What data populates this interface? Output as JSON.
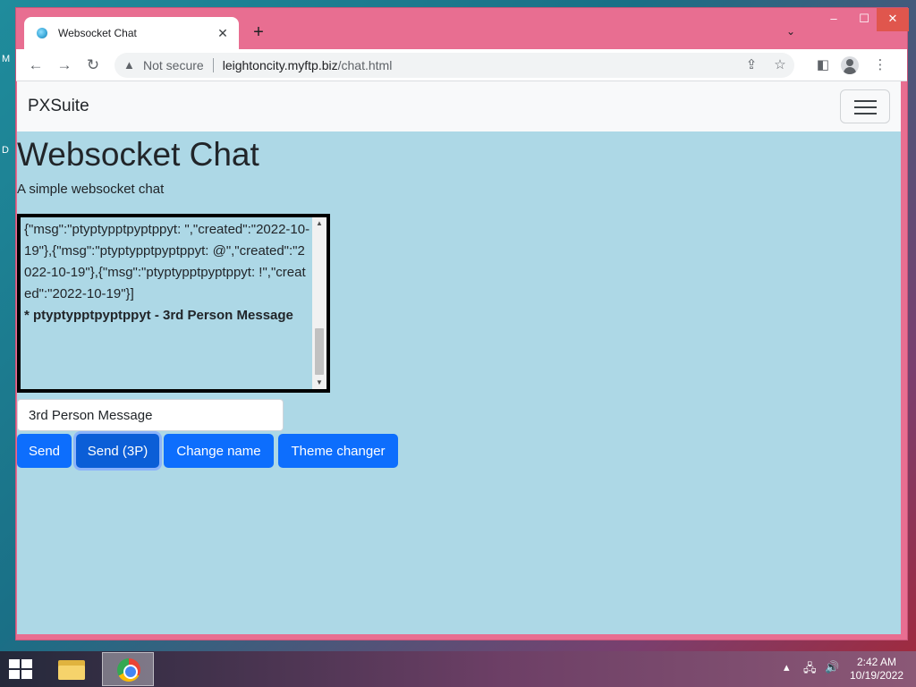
{
  "desktop": {
    "edge_labels": [
      "M",
      "D"
    ]
  },
  "browser": {
    "tab": {
      "title": "Websocket Chat"
    },
    "window_controls": {
      "minimize": "–",
      "maximize": "☐",
      "close": "✕"
    },
    "omnibox": {
      "security_label": "Not secure",
      "url_host": "leightoncity.myftp.biz",
      "url_path": "/chat.html"
    }
  },
  "page": {
    "navbar": {
      "brand": "PXSuite"
    },
    "title": "Websocket Chat",
    "subtitle": "A simple websocket chat",
    "chat_log": {
      "raw_text": "{\"msg\":\"ptyptypptpyptppyt: \",\"created\":\"2022-10-19\"},{\"msg\":\"ptyptypptpyptppyt: @\",\"created\":\"2022-10-19\"},{\"msg\":\"ptyptypptpyptppyt: !\",\"created\":\"2022-10-19\"}]",
      "latest_message": "* ptyptypptpyptppyt - 3rd Person Message"
    },
    "message_input": {
      "value": "3rd Person Message"
    },
    "buttons": {
      "send": "Send",
      "send_3p": "Send (3P)",
      "change_name": "Change name",
      "theme_changer": "Theme changer"
    }
  },
  "taskbar": {
    "clock_time": "2:42 AM",
    "clock_date": "10/19/2022"
  },
  "colors": {
    "page_background": "#add8e6",
    "primary_button": "#0d6efd",
    "window_frame": "#e86e91"
  }
}
